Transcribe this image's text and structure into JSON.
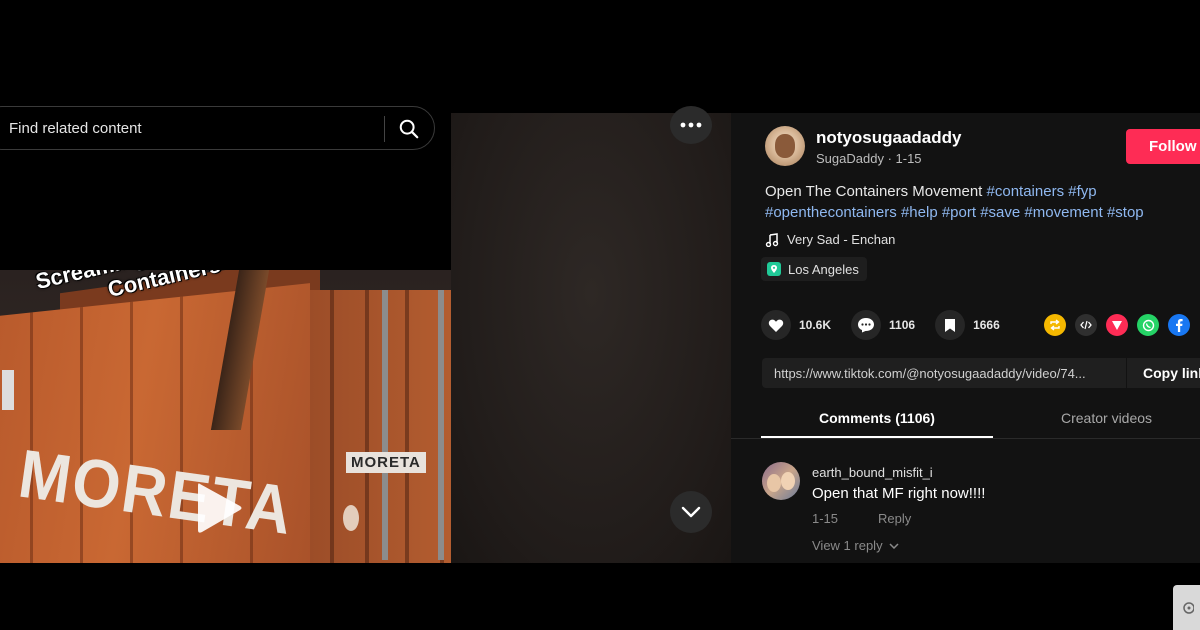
{
  "search": {
    "placeholder": "Find related content",
    "icon": "search-icon"
  },
  "thumbnail": {
    "overlay_text": "Screaming Heard In The Containers",
    "container_label_large": "MORETA",
    "container_label_small": "MORETA",
    "play_icon": "play-icon"
  },
  "video_controls": {
    "more_icon": "more-horizontal-icon",
    "next_icon": "chevron-down-icon"
  },
  "author": {
    "username": "notyosugaadaddy",
    "nickname": "SugaDaddy",
    "separator": " · ",
    "date": "1-15",
    "follow_label": "Follow"
  },
  "caption": {
    "text": "Open The Containers Movement",
    "hashtags": [
      "#containers",
      "#fyp",
      "#openthecontainers",
      "#help",
      "#port",
      "#save",
      "#movement",
      "#stop"
    ]
  },
  "music": {
    "icon": "music-note-icon",
    "title": "Very Sad - Enchan"
  },
  "location": {
    "icon": "location-pin-icon",
    "name": "Los Angeles"
  },
  "actions": {
    "likes": "10.6K",
    "comments": "1106",
    "saves": "1666"
  },
  "share": {
    "repost_icon": "repost-icon",
    "embed_icon": "embed-icon",
    "send_icon": "send-icon",
    "whatsapp_icon": "whatsapp-icon",
    "facebook_icon": "facebook-icon"
  },
  "link": {
    "url": "https://www.tiktok.com/@notyosugaadaddy/video/74...",
    "copy_label": "Copy link"
  },
  "tabs": {
    "comments": "Comments (1106)",
    "creator": "Creator videos"
  },
  "comment": {
    "username": "earth_bound_misfit_i",
    "text": "Open that MF right now!!!!",
    "date": "1-15",
    "reply_label": "Reply",
    "view_replies": "View 1 reply"
  },
  "colors": {
    "background": "#000000",
    "panel": "#121212",
    "follow": "#fe2c55",
    "hashtag": "#8fb8f0"
  }
}
